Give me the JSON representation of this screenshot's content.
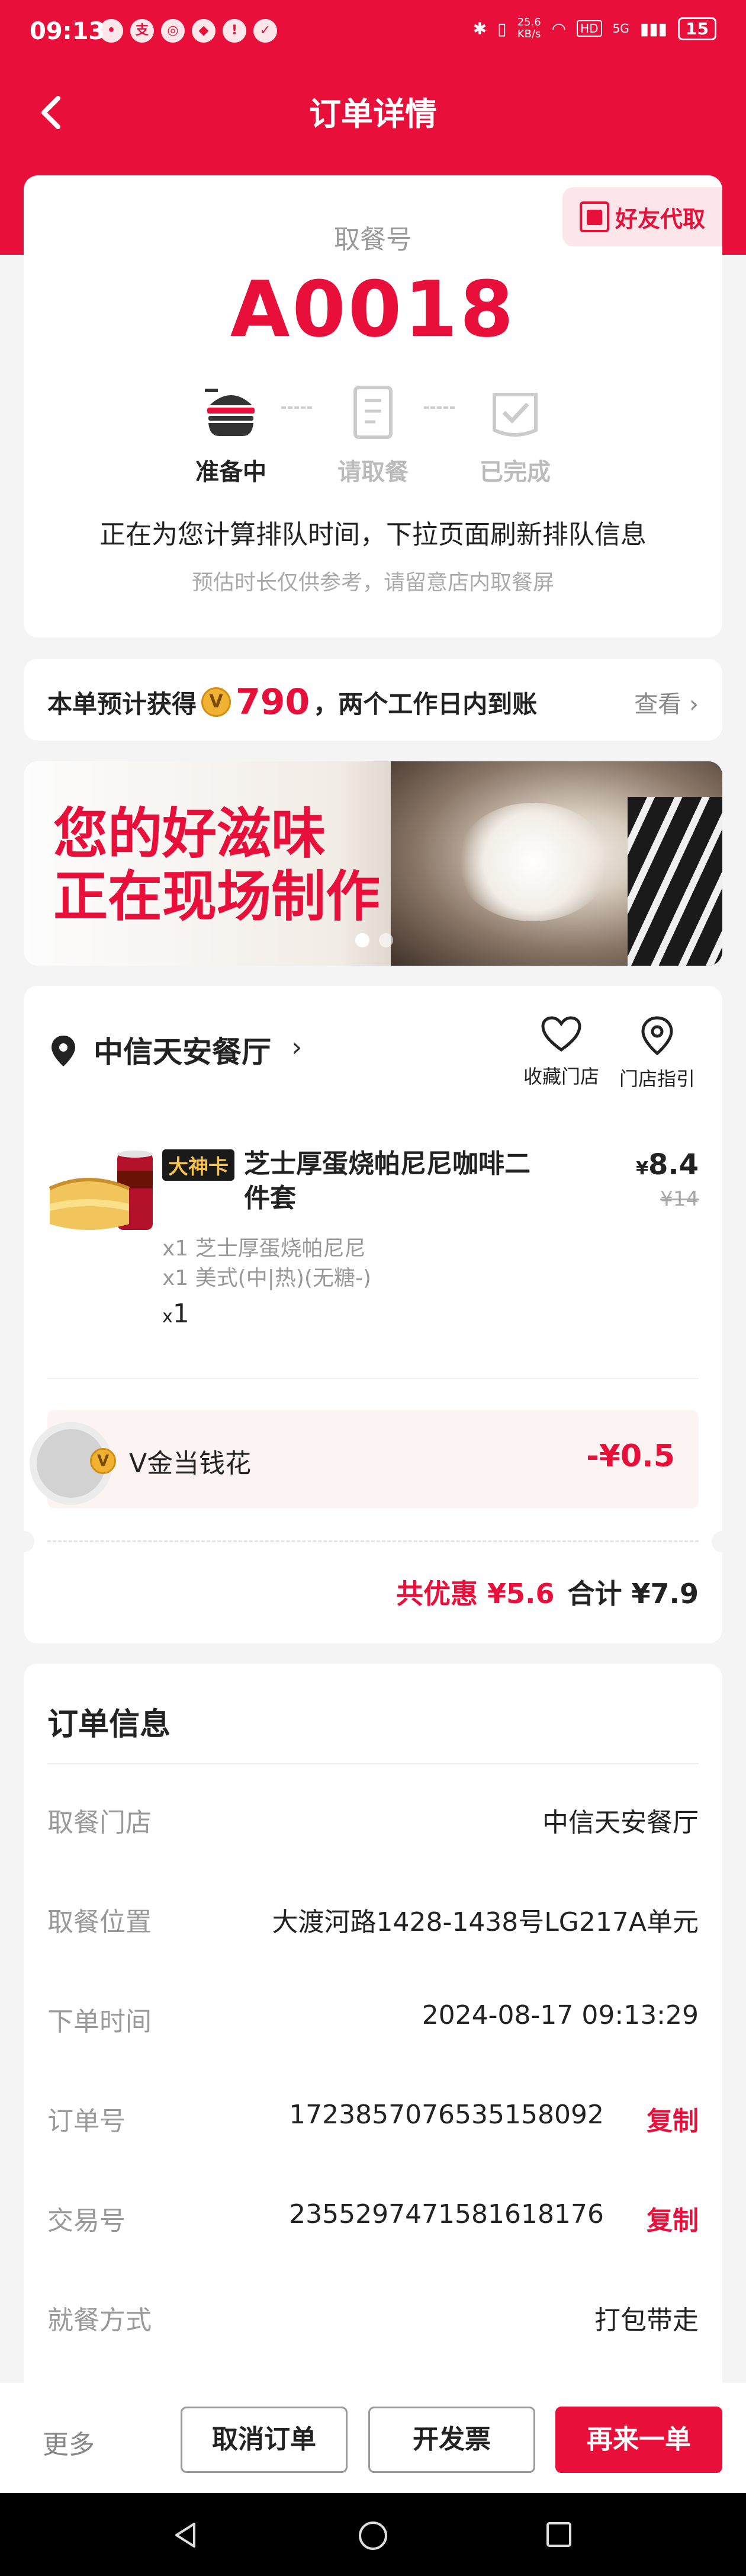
{
  "status_bar": {
    "time": "09:13",
    "net_speed": "25.6",
    "net_unit": "KB/s",
    "network_badge": "HD",
    "signal": "5G",
    "battery": "15"
  },
  "nav": {
    "title": "订单详情"
  },
  "pickup": {
    "friend_button": "好友代取",
    "label": "取餐号",
    "code": "A0018",
    "steps": [
      {
        "label": "准备中",
        "active": true
      },
      {
        "label": "请取餐",
        "active": false
      },
      {
        "label": "已完成",
        "active": false
      }
    ],
    "queue_text": "正在为您计算排队时间，下拉页面刷新排队信息",
    "queue_sub": "预估时长仅供参考，请留意店内取餐屏"
  },
  "points": {
    "prefix": "本单预计获得",
    "amount": "790",
    "suffix": "，两个工作日内到账",
    "view": "查看"
  },
  "banner": {
    "line1": "您的好滋味",
    "line2": "正在现场制作"
  },
  "store": {
    "name": "中信天安餐厅",
    "favorite": "收藏门店",
    "guide": "门店指引"
  },
  "product": {
    "badge": "大神卡",
    "name": "芝士厚蛋烧帕尼尼咖啡二件套",
    "price_symbol": "¥",
    "price": "8.4",
    "old_price": "¥14",
    "sub_items": [
      "x1 芝士厚蛋烧帕尼尼",
      "x1 美式(中|热)(无糖-)"
    ],
    "qty_prefix": "x",
    "qty": "1"
  },
  "discount": {
    "label": "V金当钱花",
    "value": "-¥0.5"
  },
  "totals": {
    "discount_label": "共优惠",
    "discount_value": "¥5.6",
    "total_label": "合计",
    "total_value": "¥7.9"
  },
  "order_info": {
    "title": "订单信息",
    "copy_label": "复制",
    "rows": [
      {
        "key": "取餐门店",
        "value": "中信天安餐厅"
      },
      {
        "key": "取餐位置",
        "value": "大渡河路1428-1438号LG217A单元"
      },
      {
        "key": "下单时间",
        "value": "2024-08-17 09:13:29"
      },
      {
        "key": "订单号",
        "value": "1723857076535158092"
      },
      {
        "key": "交易号",
        "value": "2355297471581618176"
      },
      {
        "key": "就餐方式",
        "value": "打包带走"
      }
    ]
  },
  "actions": {
    "more": "更多",
    "cancel": "取消订单",
    "invoice": "开发票",
    "reorder": "再来一单"
  },
  "colors": {
    "brand_red": "#e8103a",
    "gold": "#f0b232",
    "background": "#f4f4f4"
  },
  "icons": [
    "back-icon",
    "receipt-icon",
    "burger-icon",
    "pickup-icon",
    "done-icon",
    "vcoin-icon",
    "location-icon",
    "heart-icon",
    "map-pin-icon",
    "chevron-right-icon",
    "nav-back-icon",
    "nav-home-icon",
    "nav-recents-icon"
  ]
}
